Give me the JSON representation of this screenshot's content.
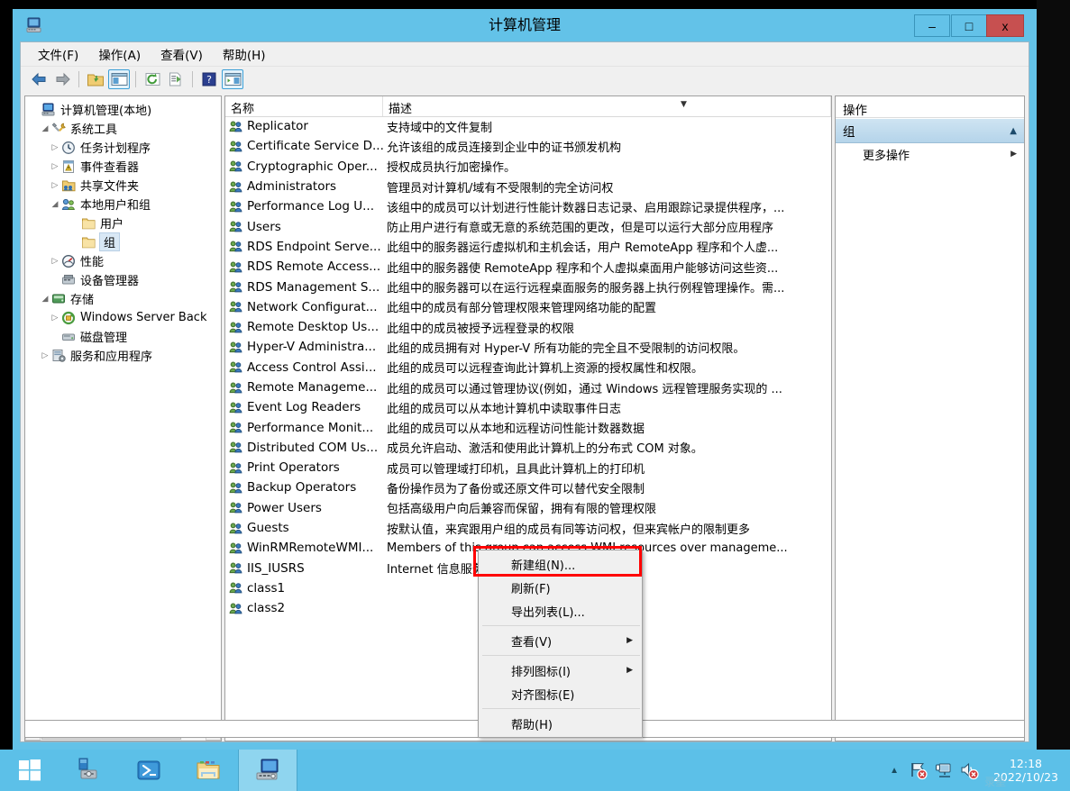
{
  "window": {
    "title": "计算机管理",
    "icon": "computer-management-icon",
    "buttons": {
      "minimize": "–",
      "maximize": "□",
      "close": "x"
    }
  },
  "menubar": [
    {
      "label": "文件(F)",
      "name": "menu-file"
    },
    {
      "label": "操作(A)",
      "name": "menu-action"
    },
    {
      "label": "查看(V)",
      "name": "menu-view"
    },
    {
      "label": "帮助(H)",
      "name": "menu-help"
    }
  ],
  "toolbar": [
    {
      "name": "back-icon",
      "glyph": "⬅",
      "active": false
    },
    {
      "name": "forward-icon",
      "glyph": "➡",
      "active": false
    },
    {
      "name": "up-folder-icon",
      "glyph": "📁",
      "active": false
    },
    {
      "name": "show-tree-icon",
      "glyph": "▤",
      "active": true
    },
    {
      "name": "refresh-icon",
      "glyph": "⟳",
      "active": false
    },
    {
      "name": "export-list-icon",
      "glyph": "☰",
      "active": false
    },
    {
      "name": "help-icon",
      "glyph": "?",
      "active": false
    },
    {
      "name": "show-action-pane-icon",
      "glyph": "▥",
      "active": true
    }
  ],
  "tree": [
    {
      "label": "计算机管理(本地)",
      "indent": 0,
      "expander": "",
      "icon": "computer-icon",
      "selected": false
    },
    {
      "label": "系统工具",
      "indent": 1,
      "expander": "◢",
      "icon": "tools-icon",
      "selected": false
    },
    {
      "label": "任务计划程序",
      "indent": 2,
      "expander": "▷",
      "icon": "clock-icon",
      "selected": false
    },
    {
      "label": "事件查看器",
      "indent": 2,
      "expander": "▷",
      "icon": "event-viewer-icon",
      "selected": false
    },
    {
      "label": "共享文件夹",
      "indent": 2,
      "expander": "▷",
      "icon": "shared-folders-icon",
      "selected": false
    },
    {
      "label": "本地用户和组",
      "indent": 2,
      "expander": "◢",
      "icon": "local-users-groups-icon",
      "selected": false
    },
    {
      "label": "用户",
      "indent": 4,
      "expander": "",
      "icon": "folder-icon",
      "selected": false
    },
    {
      "label": "组",
      "indent": 4,
      "expander": "",
      "icon": "folder-icon",
      "selected": true
    },
    {
      "label": "性能",
      "indent": 2,
      "expander": "▷",
      "icon": "performance-icon",
      "selected": false
    },
    {
      "label": "设备管理器",
      "indent": 2,
      "expander": "",
      "icon": "device-manager-icon",
      "selected": false
    },
    {
      "label": "存储",
      "indent": 1,
      "expander": "◢",
      "icon": "storage-icon",
      "selected": false
    },
    {
      "label": "Windows Server Back",
      "indent": 2,
      "expander": "▷",
      "icon": "backup-icon",
      "selected": false
    },
    {
      "label": "磁盘管理",
      "indent": 2,
      "expander": "",
      "icon": "disk-management-icon",
      "selected": false
    },
    {
      "label": "服务和应用程序",
      "indent": 1,
      "expander": "▷",
      "icon": "services-icon",
      "selected": false
    }
  ],
  "list": {
    "columns": [
      {
        "label": "名称",
        "name": "column-name"
      },
      {
        "label": "描述",
        "name": "column-description",
        "sorted": true,
        "sort_glyph": "▼"
      }
    ],
    "rows": [
      {
        "name": "Replicator",
        "desc": "支持域中的文件复制"
      },
      {
        "name": "Certificate Service D...",
        "desc": "允许该组的成员连接到企业中的证书颁发机构"
      },
      {
        "name": "Cryptographic Oper...",
        "desc": "授权成员执行加密操作。"
      },
      {
        "name": "Administrators",
        "desc": "管理员对计算机/域有不受限制的完全访问权"
      },
      {
        "name": "Performance Log U...",
        "desc": "该组中的成员可以计划进行性能计数器日志记录、启用跟踪记录提供程序，..."
      },
      {
        "name": "Users",
        "desc": "防止用户进行有意或无意的系统范围的更改，但是可以运行大部分应用程序"
      },
      {
        "name": "RDS Endpoint Serve...",
        "desc": "此组中的服务器运行虚拟机和主机会话，用户 RemoteApp 程序和个人虚..."
      },
      {
        "name": "RDS Remote Access...",
        "desc": "此组中的服务器使 RemoteApp 程序和个人虚拟桌面用户能够访问这些资..."
      },
      {
        "name": "RDS Management S...",
        "desc": "此组中的服务器可以在运行远程桌面服务的服务器上执行例程管理操作。需..."
      },
      {
        "name": "Network Configurat...",
        "desc": "此组中的成员有部分管理权限来管理网络功能的配置"
      },
      {
        "name": "Remote Desktop Us...",
        "desc": "此组中的成员被授予远程登录的权限"
      },
      {
        "name": "Hyper-V Administra...",
        "desc": "此组的成员拥有对 Hyper-V 所有功能的完全且不受限制的访问权限。"
      },
      {
        "name": "Access Control Assi...",
        "desc": "此组的成员可以远程查询此计算机上资源的授权属性和权限。"
      },
      {
        "name": "Remote Manageme...",
        "desc": "此组的成员可以通过管理协议(例如，通过 Windows 远程管理服务实现的 ..."
      },
      {
        "name": "Event Log Readers",
        "desc": "此组的成员可以从本地计算机中读取事件日志"
      },
      {
        "name": "Performance Monit...",
        "desc": "此组的成员可以从本地和远程访问性能计数器数据"
      },
      {
        "name": "Distributed COM Us...",
        "desc": "成员允许启动、激活和使用此计算机上的分布式 COM 对象。"
      },
      {
        "name": "Print Operators",
        "desc": "成员可以管理域打印机，且具此计算机上的打印机"
      },
      {
        "name": "Backup Operators",
        "desc": "备份操作员为了备份或还原文件可以替代安全限制"
      },
      {
        "name": "Power Users",
        "desc": "包括高级用户向后兼容而保留，拥有有限的管理权限"
      },
      {
        "name": "Guests",
        "desc": "按默认值，来宾跟用户组的成员有同等访问权，但来宾帐户的限制更多"
      },
      {
        "name": "WinRMRemoteWMI...",
        "desc": "Members of this group can access WMI resources over manageme..."
      },
      {
        "name": "IIS_IUSRS",
        "desc": "Internet 信息服务使用的内置组。"
      },
      {
        "name": "class1",
        "desc": ""
      },
      {
        "name": "class2",
        "desc": ""
      }
    ]
  },
  "action_pane": {
    "header": "操作",
    "section": {
      "title": "组",
      "collapse_glyph": "▲"
    },
    "items": [
      {
        "label": "更多操作",
        "submenu_glyph": "▶",
        "name": "action-more-actions"
      }
    ]
  },
  "context_menu": {
    "items": [
      {
        "label": "新建组(N)...",
        "name": "ctx-new-group",
        "submenu": "",
        "highlighted": true
      },
      {
        "label": "刷新(F)",
        "name": "ctx-refresh",
        "submenu": ""
      },
      {
        "label": "导出列表(L)...",
        "name": "ctx-export-list",
        "submenu": ""
      },
      {
        "sep": true
      },
      {
        "label": "查看(V)",
        "name": "ctx-view",
        "submenu": "▶"
      },
      {
        "sep": true
      },
      {
        "label": "排列图标(I)",
        "name": "ctx-arrange-icons",
        "submenu": "▶"
      },
      {
        "label": "对齐图标(E)",
        "name": "ctx-align-icons",
        "submenu": ""
      },
      {
        "sep": true
      },
      {
        "label": "帮助(H)",
        "name": "ctx-help",
        "submenu": ""
      }
    ],
    "highlight_color": "#ff0000"
  },
  "tree_scrollbar": {
    "left_glyph": "‹",
    "right_glyph": "›",
    "thumb_glyph": "|||"
  },
  "taskbar": {
    "items": [
      {
        "name": "start-button",
        "icon": "windows-logo-icon",
        "active": false
      },
      {
        "name": "taskbar-server-manager",
        "icon": "server-manager-icon",
        "active": false
      },
      {
        "name": "taskbar-powershell",
        "icon": "powershell-icon",
        "active": false
      },
      {
        "name": "taskbar-file-explorer",
        "icon": "file-explorer-icon",
        "active": false
      },
      {
        "name": "taskbar-computer-management",
        "icon": "computer-management-icon",
        "active": true
      }
    ],
    "tray": {
      "expand_glyph": "▲",
      "icons": [
        {
          "name": "flag-action-center-icon"
        },
        {
          "name": "network-icon"
        },
        {
          "name": "volume-muted-icon"
        }
      ]
    },
    "clock": {
      "time": "12:18",
      "date": "2022/10/23",
      "watermark": "录星"
    }
  },
  "colors": {
    "window_frame": "#63c2e8",
    "close_button": "#c75050",
    "selection": "#d9e8f5",
    "action_section": "#b5d4ea",
    "highlight": "#ff0000",
    "taskbar": "#5cc0e8"
  }
}
